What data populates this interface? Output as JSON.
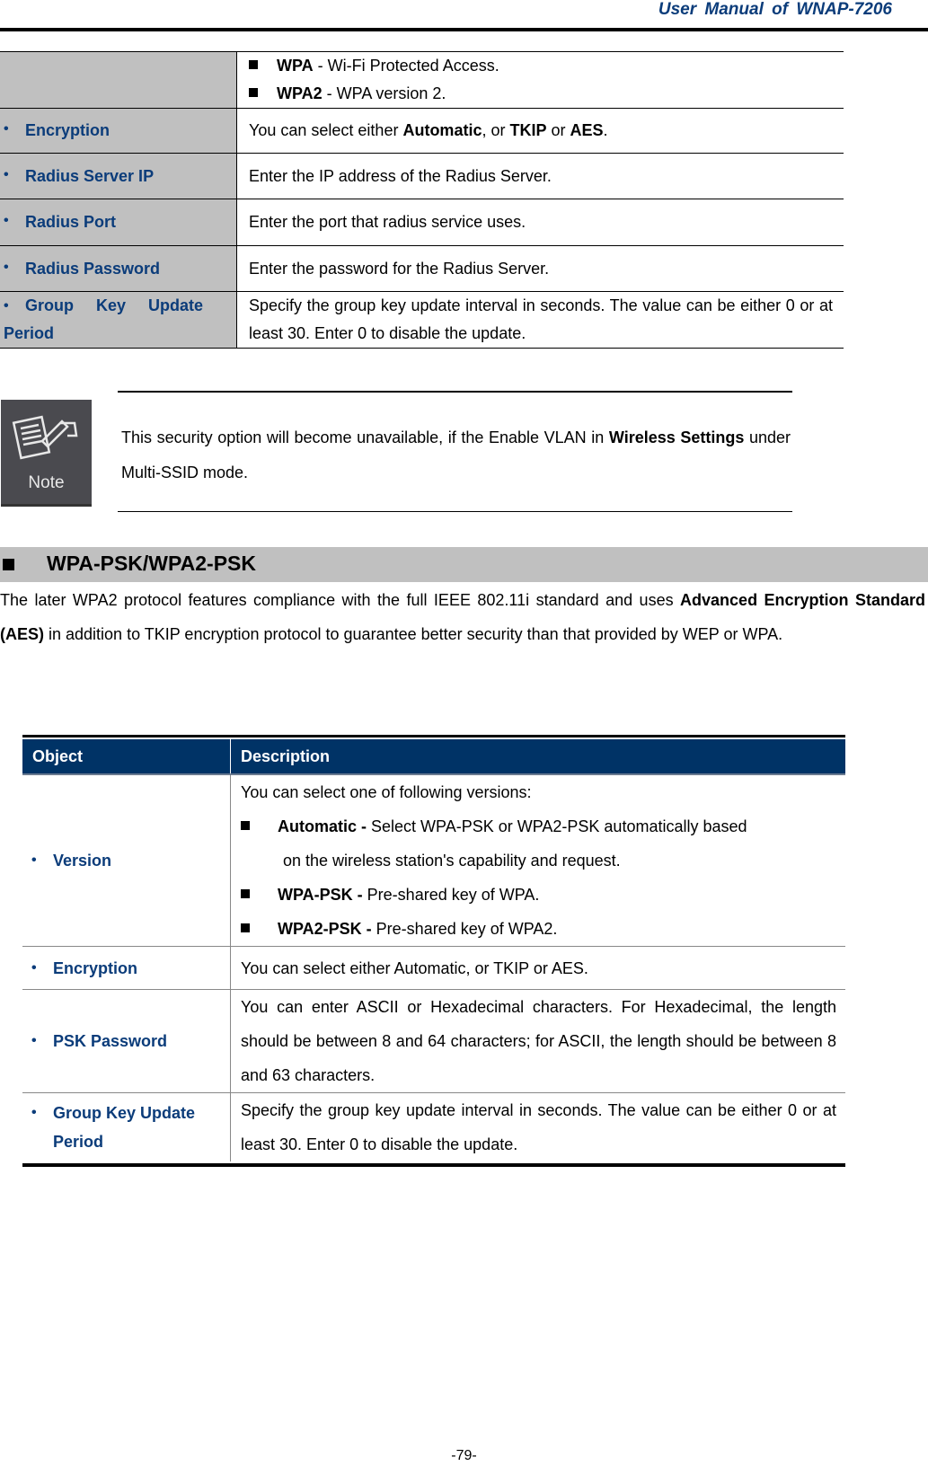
{
  "header": {
    "title": "User  Manual  of  WNAP-7206"
  },
  "table1": {
    "rows": [
      {
        "object": "",
        "items": [
          {
            "bold": "WPA",
            "text": " - Wi-Fi Protected Access."
          },
          {
            "bold": "WPA2",
            "text": " - WPA version 2."
          }
        ]
      },
      {
        "object": "Encryption",
        "desc_parts": [
          "You can select either ",
          "Automatic",
          ", or ",
          "TKIP",
          " or ",
          "AES",
          "."
        ]
      },
      {
        "object": "Radius Server IP",
        "desc": "Enter the IP address of the Radius Server."
      },
      {
        "object": "Radius Port",
        "desc": "Enter the port that radius service uses."
      },
      {
        "object": "Radius Password",
        "desc": "Enter the password for the Radius Server."
      },
      {
        "object_line1": "Group     Key     Update",
        "object_line2": "Period",
        "desc": "Specify the group key update interval in seconds. The value can be either 0 or at least 30. Enter 0 to disable the update."
      }
    ]
  },
  "note": {
    "icon_label": "Note",
    "text_before": "This security option will become unavailable, if the Enable VLAN in ",
    "bold1": "Wireless Settings",
    "text_after": " under Multi-SSID mode."
  },
  "section": {
    "title": "WPA-PSK/WPA2-PSK",
    "para_before": "The later WPA2 protocol features compliance with the full IEEE 802.11i standard and uses ",
    "para_bold": "Advanced Encryption Standard (AES)",
    "para_after": " in addition to TKIP encryption protocol to guarantee better security than that provided by WEP or WPA."
  },
  "table2": {
    "headers": [
      "Object",
      "Description"
    ],
    "version": {
      "object": "Version",
      "intro": "You can select one of following versions:",
      "items": [
        {
          "bold": "Automatic - ",
          "text": "Select WPA-PSK or WPA2-PSK automatically based",
          "cont": "on the wireless station's capability and request."
        },
        {
          "bold": "WPA-PSK - ",
          "text": "Pre-shared key of WPA."
        },
        {
          "bold": "WPA2-PSK - ",
          "text": "Pre-shared key of WPA2."
        }
      ]
    },
    "encryption": {
      "object": "Encryption",
      "desc": "You can select either Automatic, or TKIP or AES."
    },
    "psk": {
      "object": "PSK Password",
      "desc": "You can enter ASCII or Hexadecimal characters. For Hexadecimal, the length should be between 8 and 64 characters; for ASCII, the length should be between 8 and 63 characters."
    },
    "group": {
      "object_line1": "Group Key Update",
      "object_line2": "Period",
      "desc": "Specify the group key update interval in seconds. The value can be either 0 or at least 30. Enter 0 to disable the update."
    }
  },
  "footer": {
    "page_number": "-79-"
  }
}
